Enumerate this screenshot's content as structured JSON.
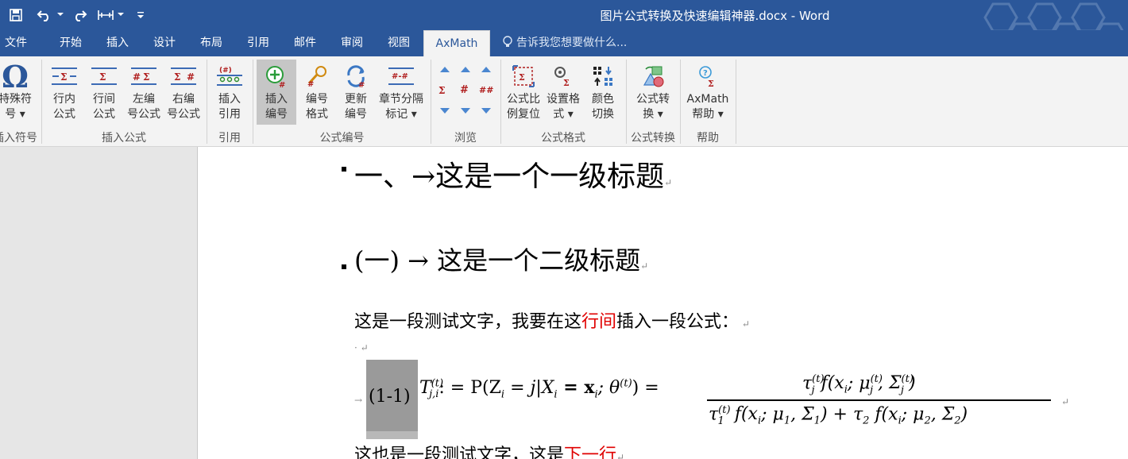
{
  "window": {
    "title": "图片公式转换及快速编辑神器.docx - Word"
  },
  "tabs": [
    {
      "label": "文件"
    },
    {
      "label": "开始"
    },
    {
      "label": "插入"
    },
    {
      "label": "设计"
    },
    {
      "label": "布局"
    },
    {
      "label": "引用"
    },
    {
      "label": "邮件"
    },
    {
      "label": "审阅"
    },
    {
      "label": "视图"
    },
    {
      "label": "AxMath"
    }
  ],
  "tellme": "告诉我您想要做什么...",
  "ribbon": {
    "special_symbol": "特殊符\n号 ▾",
    "group_symbol": "插入符号",
    "inline_formula": "行内\n公式",
    "display_formula": "行间\n公式",
    "left_num_formula": "左编\n号公式",
    "right_num_formula": "右编\n号公式",
    "group_insert_formula": "插入公式",
    "insert_ref": "插入\n引用",
    "group_ref": "引用",
    "insert_num": "插入\n编号",
    "num_format": "编号\n格式",
    "update_num": "更新\n编号",
    "chapter_mark": "章节分隔\n标记 ▾",
    "group_formula_num": "公式编号",
    "group_browse": "浏览",
    "scale_reset": "公式比\n例复位",
    "set_format": "设置格\n式 ▾",
    "color_switch": "颜色\n切换",
    "group_formula_format": "公式格式",
    "formula_convert": "公式转\n换 ▾",
    "group_formula_convert": "公式转换",
    "axmath_help": "AxMath\n帮助 ▾",
    "group_help": "帮助"
  },
  "document": {
    "heading1": "一、→这是一个一级标题",
    "heading2": "(一) → 这是一个二级标题",
    "para1_before": "这是一段测试文字，我要在这",
    "para1_red": "行间",
    "para1_after": "插入一段公式：",
    "eq_label": "(1-1)",
    "eq_lhs": "T",
    "eq_lhs_sup": "(t)",
    "eq_lhs_sub": "j,i",
    "eq_mid": ": = P(Z",
    "eq_mid_sub": "i",
    "eq_mid2": " = j|X",
    "eq_mid2_sub": "i",
    "eq_mid3": " = x",
    "eq_mid3_sub": "i",
    "eq_mid4": "; θ",
    "eq_mid4_sup": "(t)",
    "eq_mid5": ") =",
    "frac_num": "τ",
    "frac_num_rest": "f(x",
    "frac_num_rest2": "; μ",
    "frac_num_rest3": ", Σ",
    "frac_num_end": ")",
    "frac_den": "τ",
    "frac_den_rest": " f(x",
    "frac_den_rest2": "; μ",
    "frac_den_rest3": ", Σ",
    "frac_den_mid": ") + τ",
    "frac_den_rest4": " f(x",
    "frac_den_rest5": "; μ",
    "frac_den_rest6": ", Σ",
    "frac_den_end": ")",
    "sup_t": "(t)",
    "sub_j": "j",
    "sub_i": "i",
    "sub_1": "1",
    "sub_2": "2",
    "para2_before": "这也是一段测试文字，这是",
    "para2_red": "下一行"
  },
  "colors": {
    "word_blue": "#2b579a",
    "ribbon_bg": "#f3f3f3",
    "red_text": "#e00000"
  }
}
